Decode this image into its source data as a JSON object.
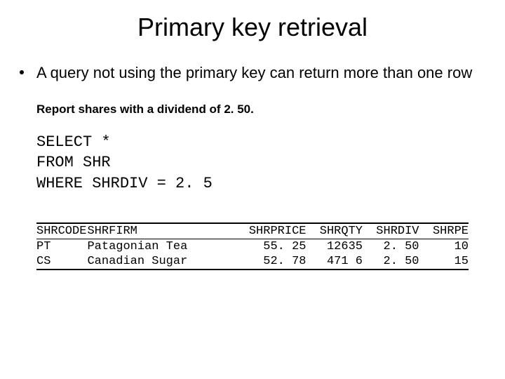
{
  "title": "Primary key retrieval",
  "bullet1": "A query not using the primary key can return more than one row",
  "subnote": "Report shares with a dividend of 2. 50.",
  "code": {
    "line1": "SELECT *",
    "line2": "FROM SHR",
    "line3": "WHERE SHRDIV = 2. 5"
  },
  "table": {
    "headers": {
      "code": "SHRCODE",
      "firm": "SHRFIRM",
      "price": "SHRPRICE",
      "qty": "SHRQTY",
      "div": "SHRDIV",
      "pe": "SHRPE"
    },
    "rows": [
      {
        "code": "PT",
        "firm": "Patagonian Tea",
        "price": "55. 25",
        "qty": "12635",
        "div": "2. 50",
        "pe": "10"
      },
      {
        "code": "CS",
        "firm": "Canadian Sugar",
        "price": "52. 78",
        "qty": "471 6",
        "div": "2. 50",
        "pe": "15"
      }
    ]
  }
}
